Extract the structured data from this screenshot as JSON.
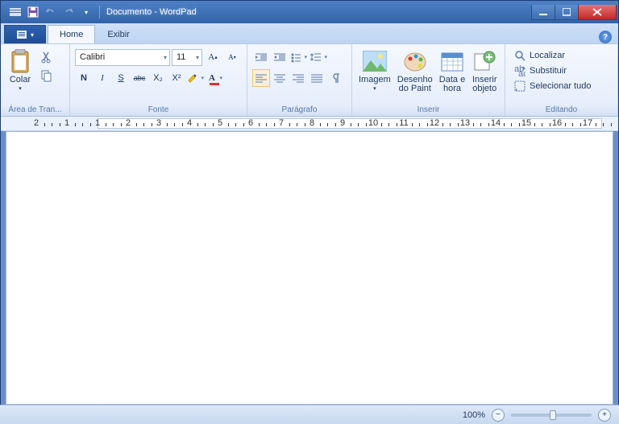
{
  "window": {
    "title": "Documento - WordPad"
  },
  "tabs": {
    "file": "",
    "home": "Home",
    "view": "Exibir"
  },
  "clipboard": {
    "paste": "Colar",
    "label": "Área de Tran..."
  },
  "font": {
    "family": "Calibri",
    "size": "11",
    "label": "Fonte",
    "bold": "N",
    "italic": "I",
    "underline": "S",
    "strike": "abc",
    "sub": "X₂",
    "sup": "X²"
  },
  "paragraph": {
    "label": "Parágrafo"
  },
  "insert": {
    "image": "Imagem",
    "paint": "Desenho\ndo Paint",
    "date": "Data e\nhora",
    "object": "Inserir\nobjeto",
    "label": "Inserir"
  },
  "editing": {
    "find": "Localizar",
    "replace": "Substituir",
    "selectall": "Selecionar tudo",
    "label": "Editando"
  },
  "statusbar": {
    "zoom": "100%"
  },
  "ruler": {
    "numbers": [
      "2",
      "1",
      "1",
      "2",
      "3",
      "4",
      "5",
      "6",
      "7",
      "8",
      "9",
      "10",
      "11",
      "12",
      "13",
      "14",
      "15",
      "16",
      "17"
    ]
  }
}
